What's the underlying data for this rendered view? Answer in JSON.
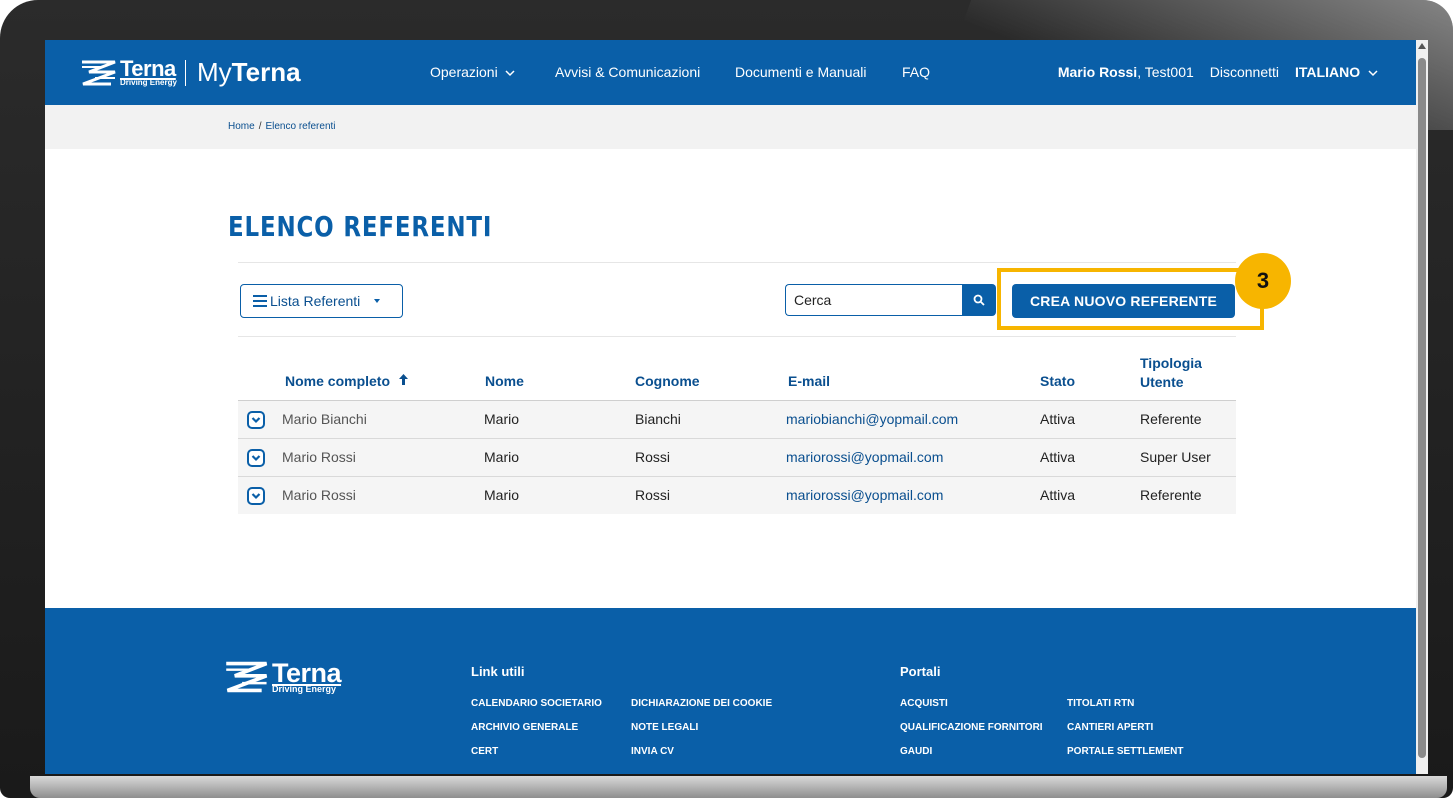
{
  "header": {
    "brand_small": "Terna",
    "brand_tagline": "Driving Energy",
    "app_prefix": "My",
    "app_name": "Terna",
    "nav": [
      "Operazioni",
      "Avvisi & Comunicazioni",
      "Documenti e Manuali",
      "FAQ"
    ],
    "user_name": "Mario Rossi",
    "user_code": ", Test001",
    "logout": "Disconnetti",
    "language": "ITALIANO"
  },
  "breadcrumb": {
    "home": "Home",
    "separator": "/",
    "current": "Elenco referenti"
  },
  "page": {
    "title": "ELENCO REFERENTI",
    "view_selector": "Lista Referenti",
    "search_placeholder": "Cerca",
    "create_button": "CREA NUOVO REFERENTE",
    "step_number": "3"
  },
  "table": {
    "headers": {
      "full_name": "Nome completo",
      "first_name": "Nome",
      "last_name": "Cognome",
      "email": "E-mail",
      "status": "Stato",
      "type_line1": "Tipologia",
      "type_line2": "Utente"
    },
    "rows": [
      {
        "full_name": "Mario Bianchi",
        "first_name": "Mario",
        "last_name": "Bianchi",
        "email": "mariobianchi@yopmail.com",
        "status": "Attiva",
        "type": "Referente"
      },
      {
        "full_name": "Mario Rossi",
        "first_name": "Mario",
        "last_name": "Rossi",
        "email": "mariorossi@yopmail.com",
        "status": "Attiva",
        "type": "Super User"
      },
      {
        "full_name": "Mario Rossi",
        "first_name": "Mario",
        "last_name": "Rossi",
        "email": "mariorossi@yopmail.com",
        "status": "Attiva",
        "type": "Referente"
      }
    ]
  },
  "footer": {
    "brand": "Terna",
    "tagline": "Driving Energy",
    "link_utili_title": "Link utili",
    "link_utili_col1": [
      "CALENDARIO SOCIETARIO",
      "ARCHIVIO GENERALE",
      "CERT"
    ],
    "link_utili_col2": [
      "DICHIARAZIONE DEI COOKIE",
      "NOTE LEGALI",
      "INVIA CV"
    ],
    "portali_title": "Portali",
    "portali_col1": [
      "ACQUISTI",
      "QUALIFICAZIONE FORNITORI",
      "GAUDI"
    ],
    "portali_col2": [
      "TITOLATI RTN",
      "CANTIERI APERTI",
      "PORTALE SETTLEMENT"
    ]
  },
  "colors": {
    "brand_blue": "#0a5fa8",
    "highlight": "#f7b500"
  }
}
